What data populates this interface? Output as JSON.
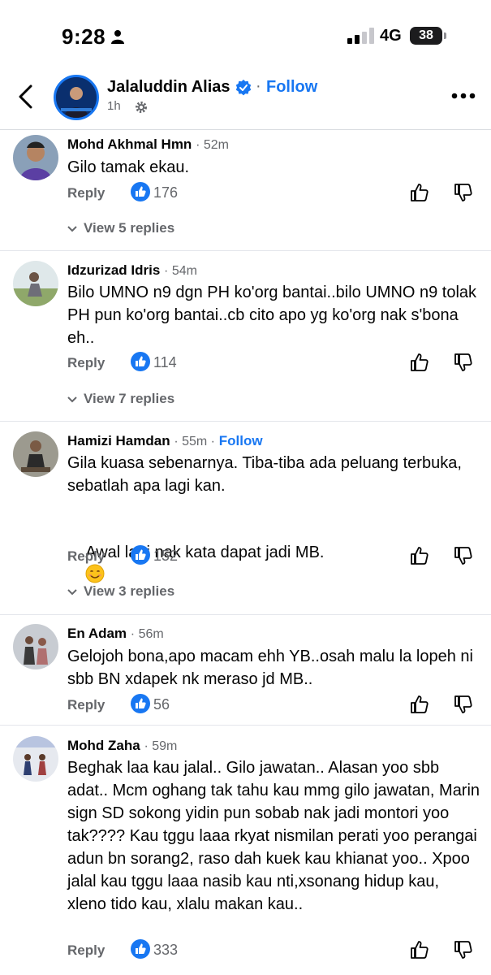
{
  "status": {
    "time": "9:28",
    "network": "4G",
    "battery": "38"
  },
  "header": {
    "page_name": "Jalaluddin Alias",
    "follow_label": "Follow",
    "time_ago": "1h"
  },
  "comments": [
    {
      "name": "Mohd Akhmal Hmn",
      "time": "52m",
      "text": "Gilo tamak ekau.",
      "reply_label": "Reply",
      "likes": "176",
      "view_replies": "View 5 replies"
    },
    {
      "name": "Idzurizad Idris",
      "time": "54m",
      "text": "Bilo UMNO n9 dgn PH ko'org bantai..bilo UMNO n9 tolak PH pun ko'org bantai..cb cito apo yg ko'org nak s'bona eh..",
      "reply_label": "Reply",
      "likes": "114",
      "view_replies": "View 7 replies"
    },
    {
      "name": "Hamizi Hamdan",
      "time": "55m",
      "follow_label": "Follow",
      "text": "Gila kuasa sebenarnya. Tiba-tiba ada peluang terbuka, sebatlah apa lagi kan.",
      "text2": "Awal lagi nak kata dapat jadi MB.",
      "reply_label": "Reply",
      "likes": "152",
      "view_replies": "View 3 replies"
    },
    {
      "name": "En Adam",
      "time": "56m",
      "text": "Gelojoh bona,apo macam ehh YB..osah malu la lopeh ni sbb BN xdapek nk meraso jd MB..",
      "reply_label": "Reply",
      "likes": "56"
    },
    {
      "name": "Mohd Zaha",
      "time": "59m",
      "text": "Beghak laa kau jalal.. Gilo jawatan.. Alasan yoo sbb adat.. Mcm oghang tak tahu kau mmg gilo jawatan, Marin sign SD sokong yidin pun sobab nak jadi montori yoo tak???? Kau tggu laaa rkyat nismilan perati yoo perangai adun bn sorang2, raso dah kuek kau khianat yoo.. Xpoo jalal kau tggu laaa nasib kau nti,xsonang hidup kau, xleno tido kau, xlalu makan kau..",
      "reply_label": "Reply",
      "likes": "333"
    }
  ],
  "colors": {
    "accent": "#1877f2",
    "muted": "#65676b"
  },
  "icons": [
    "back-chevron-icon",
    "verified-badge-icon",
    "gear-icon",
    "more-horizontal-icon",
    "like-badge-icon",
    "thumbs-up-icon",
    "thumbs-down-icon",
    "chevron-down-icon",
    "smiling-face-emoji"
  ]
}
